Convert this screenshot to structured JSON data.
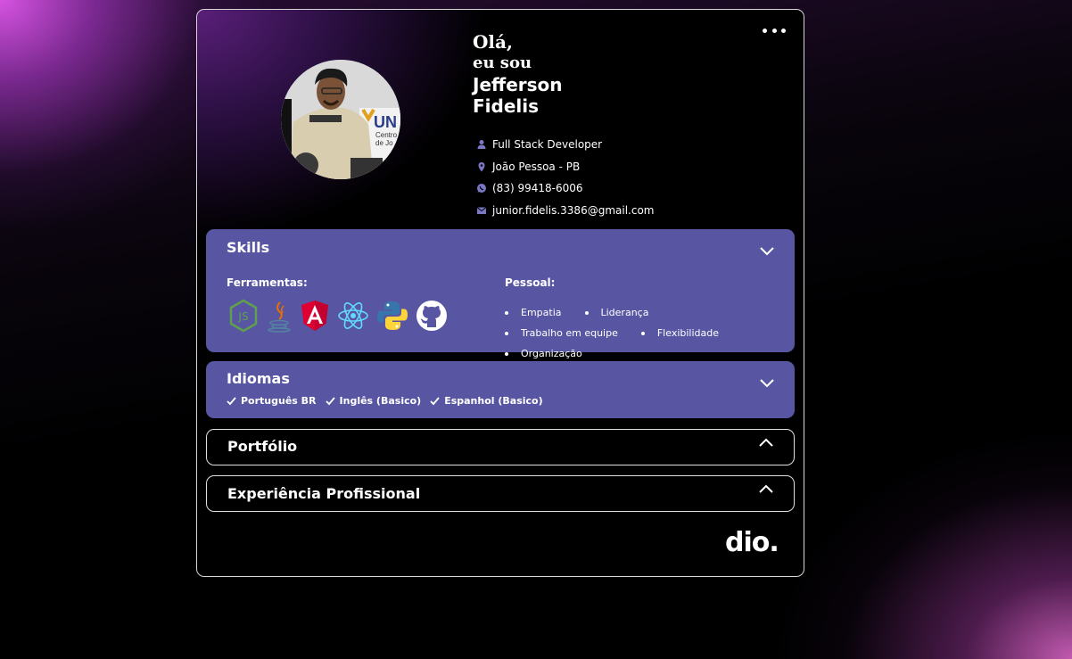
{
  "header": {
    "greeting_line1": "Olá,",
    "greeting_line2": "eu sou",
    "name_line1": "Jefferson",
    "name_line2": "Fidelis",
    "info": [
      {
        "icon": "person-icon",
        "text": "Full Stack Developer"
      },
      {
        "icon": "location-pin-icon",
        "text": "João Pessoa - PB"
      },
      {
        "icon": "whatsapp-icon",
        "text": "(83) 99418-6006"
      },
      {
        "icon": "mail-icon",
        "text": "junior.fidelis.3386@gmail.com"
      }
    ]
  },
  "skills": {
    "title": "Skills",
    "tools_label": "Ferramentas:",
    "tools": [
      "nodejs-icon",
      "java-icon",
      "angular-icon",
      "react-icon",
      "python-icon",
      "github-icon"
    ],
    "personal_label": "Pessoal:",
    "personal": [
      "Empatia",
      "Liderança",
      "Trabalho em equipe",
      "Flexibilidade",
      "Organização"
    ]
  },
  "languages": {
    "title": "Idiomas",
    "items": [
      "Português BR",
      "Inglês (Basico)",
      "Espanhol (Basico)"
    ]
  },
  "portfolio": {
    "title": "Portfólio"
  },
  "experience": {
    "title": "Experiência Profissional"
  },
  "logo": {
    "text": "dio."
  },
  "colors": {
    "accent": "#5856a3",
    "icon": "#7a78c4"
  }
}
